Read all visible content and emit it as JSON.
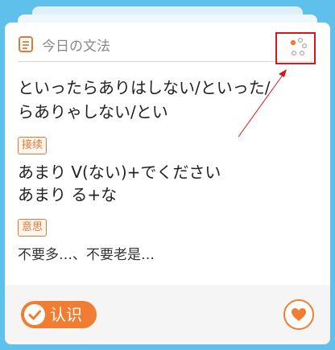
{
  "header": {
    "title": "今日の文法",
    "icon": "notebook-icon",
    "settings_icon": "dots-settings-icon"
  },
  "grammar": {
    "line1": "といったらありはしない/といった/",
    "line2": "らありゃしない/とい"
  },
  "sections": {
    "connection_tag": "接续",
    "pattern_line1": "あまり V(ない)+でください",
    "pattern_line2": "あまり る+な",
    "meaning_tag": "意思",
    "meaning": "不要多…、不要老是…"
  },
  "footer": {
    "know_label": "认识",
    "know_icon": "check-circle-icon",
    "fav_icon": "heart-icon"
  },
  "colors": {
    "accent": "#f07d32",
    "highlight": "#d3181e",
    "background": "#5fc0ec"
  }
}
